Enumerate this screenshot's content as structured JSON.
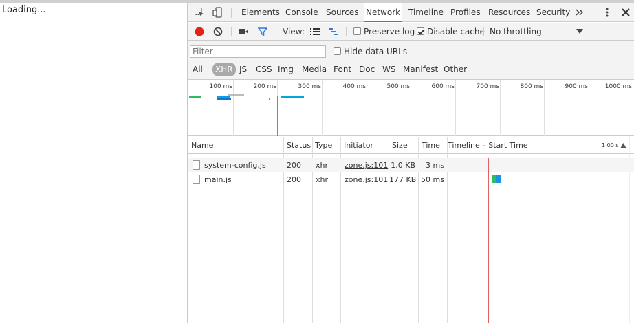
{
  "page": {
    "text": "Loading..."
  },
  "tabs": [
    {
      "label": "Elements"
    },
    {
      "label": "Console"
    },
    {
      "label": "Sources"
    },
    {
      "label": "Network"
    },
    {
      "label": "Timeline"
    },
    {
      "label": "Profiles"
    },
    {
      "label": "Resources"
    },
    {
      "label": "Security"
    }
  ],
  "toolbar": {
    "view_label": "View:",
    "preserve_log": "Preserve log",
    "disable_cache": "Disable cache",
    "throttling": "No throttling"
  },
  "filter": {
    "placeholder": "Filter",
    "hide_data_urls": "Hide data URLs",
    "types": [
      "All",
      "XHR",
      "JS",
      "CSS",
      "Img",
      "Media",
      "Font",
      "Doc",
      "WS",
      "Manifest",
      "Other"
    ]
  },
  "overview": {
    "ticks": [
      "100 ms",
      "200 ms",
      "300 ms",
      "400 ms",
      "500 ms",
      "600 ms",
      "700 ms",
      "800 ms",
      "900 ms",
      "1000 ms"
    ]
  },
  "table": {
    "headers": [
      "Name",
      "Status",
      "Type",
      "Initiator",
      "Size",
      "Time",
      "Timeline – Start Time"
    ],
    "timeline_scale": "1.00 s",
    "rows": [
      {
        "name": "system-config.js",
        "status": "200",
        "type": "xhr",
        "initiator": "zone.js:101",
        "size": "1.0 KB",
        "time": "3 ms"
      },
      {
        "name": "main.js",
        "status": "200",
        "type": "xhr",
        "initiator": "zone.js:101",
        "size": "177 KB",
        "time": "50 ms"
      }
    ]
  },
  "colors": {
    "accent": "#3879d9",
    "record": "#e3201b",
    "waiting": "#00a6dc",
    "download": "#1f6fd1",
    "green": "#2dbd60"
  }
}
